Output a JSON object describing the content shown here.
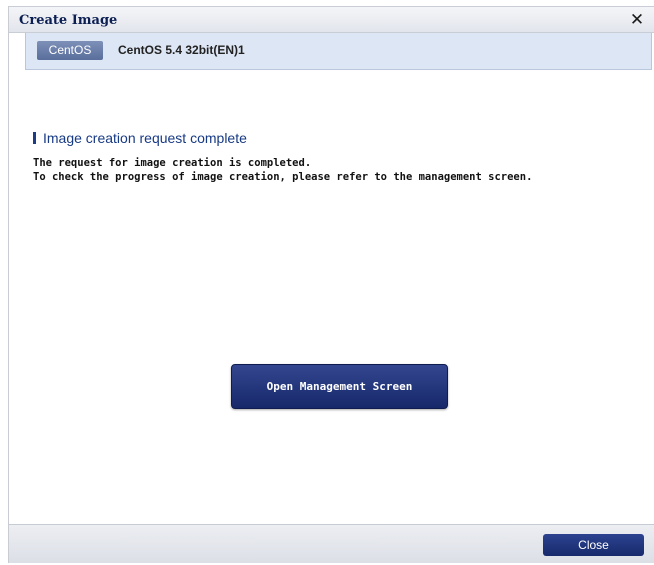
{
  "dialog": {
    "title": "Create Image",
    "close_glyph": "✕",
    "close_icon": "close-icon"
  },
  "image": {
    "os_badge": "CentOS",
    "name": "CentOS 5.4 32bit(EN)1"
  },
  "content": {
    "heading": "Image creation request complete",
    "message_line1": "The request for image creation is completed.",
    "message_line2": "To check the progress of image creation, please refer to the management screen."
  },
  "actions": {
    "open_management_label": "Open Management Screen",
    "close_label": "Close"
  },
  "colors": {
    "accent": "#17286a",
    "heading": "#173a84",
    "title": "#0c1f52",
    "info_bar": "#dde6f4"
  }
}
